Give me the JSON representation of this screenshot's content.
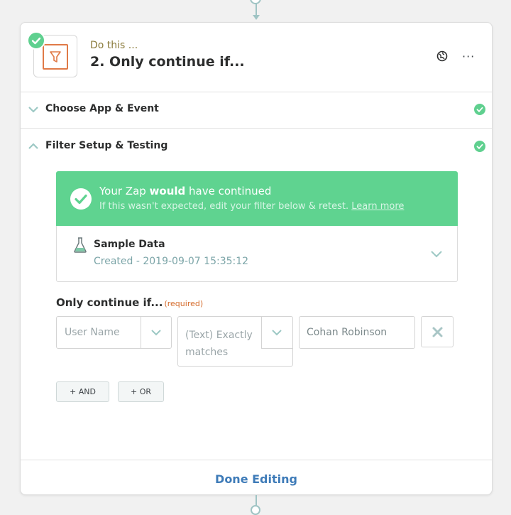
{
  "step": {
    "kicker": "Do this ...",
    "title": "2. Only continue if...",
    "more_label": "···"
  },
  "sections": [
    {
      "label": "Choose App & Event",
      "state": "collapsed",
      "status": "complete"
    },
    {
      "label": "Filter Setup & Testing",
      "state": "expanded",
      "status": "complete"
    }
  ],
  "result": {
    "title_prefix": "Your Zap ",
    "title_bold": "would",
    "title_suffix": " have continued",
    "subtitle": "If this wasn't expected, edit your filter below & retest.",
    "learn_more": "Learn more"
  },
  "sample": {
    "title": "Sample Data",
    "created": "Created - 2019-09-07 15:35:12"
  },
  "filter": {
    "label": "Only continue if...",
    "required": "(required)",
    "field": "User Name",
    "condition": "(Text) Exactly matches",
    "value": "Cohan Robinson"
  },
  "buttons": {
    "and": "+ AND",
    "or": "+ OR",
    "done": "Done Editing"
  },
  "colors": {
    "success": "#5fd390",
    "accent_orange": "#e07a47",
    "link_blue": "#3e7bb8"
  }
}
